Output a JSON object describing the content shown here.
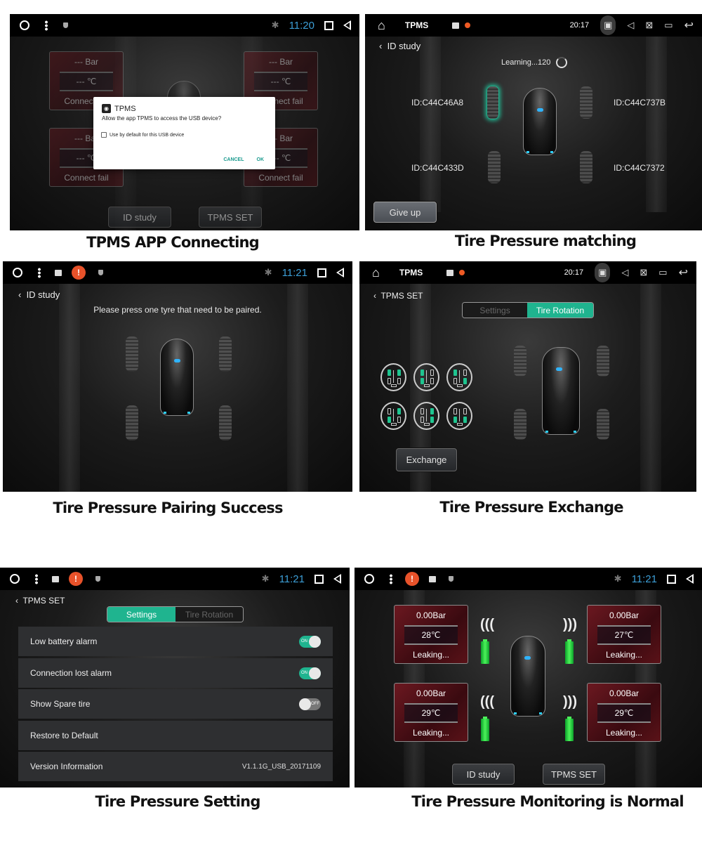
{
  "captions": {
    "p1": "TPMS APP Connecting",
    "p2": "Tire Pressure matching",
    "p3": "Tire Pressure Pairing Success",
    "p4": "Tire Pressure Exchange",
    "p5": "Tire Pressure Setting",
    "p6": "Tire Pressure Monitoring is Normal"
  },
  "panel1": {
    "status": {
      "time": "11:20"
    },
    "cards": [
      {
        "pressure": "--- Bar",
        "temp": "--- ℃",
        "status": "Connect fail"
      },
      {
        "pressure": "--- Bar",
        "temp": "--- ℃",
        "status": "Connect fail"
      },
      {
        "pressure": "--- Bar",
        "temp": "--- ℃",
        "status": "Connect fail"
      },
      {
        "pressure": "--- Bar",
        "temp": "--- ℃",
        "status": "Connect fail"
      }
    ],
    "buttons": {
      "id_study": "ID study",
      "tpms_set": "TPMS SET"
    },
    "dialog": {
      "app_name": "TPMS",
      "message": "Allow the app TPMS to access the USB device?",
      "checkbox_label": "Use by default for this USB device",
      "checkbox_checked": false,
      "cancel": "CANCEL",
      "ok": "OK"
    }
  },
  "panel2": {
    "status": {
      "app_title": "TPMS",
      "time": "20:17"
    },
    "back_label": "ID study",
    "learning": "Learning...120",
    "ids": {
      "fl": "ID:C44C46A8",
      "fr": "ID:C44C737B",
      "rl": "ID:C44C433D",
      "rr": "ID:C44C7372"
    },
    "give_up": "Give up"
  },
  "panel3": {
    "status": {
      "time": "11:21"
    },
    "back_label": "ID study",
    "instruction": "Please press one tyre that need to be paired."
  },
  "panel4": {
    "status": {
      "app_title": "TPMS",
      "time": "20:17"
    },
    "back_label": "TPMS SET",
    "tabs": {
      "settings": "Settings",
      "rotation": "Tire Rotation",
      "active": "Tire Rotation"
    },
    "exchange": "Exchange"
  },
  "panel5": {
    "status": {
      "time": "11:21"
    },
    "back_label": "TPMS SET",
    "tabs": {
      "settings": "Settings",
      "rotation": "Tire Rotation",
      "active": "Settings"
    },
    "rows": [
      {
        "label": "Low battery alarm",
        "toggle": "ON"
      },
      {
        "label": "Connection lost alarm",
        "toggle": "ON"
      },
      {
        "label": "Show Spare tire",
        "toggle": "OFF"
      },
      {
        "label": "Restore to Default"
      },
      {
        "label": "Version Information",
        "value": "V1.1.1G_USB_20171109"
      }
    ]
  },
  "panel6": {
    "status": {
      "time": "11:21"
    },
    "cards": [
      {
        "pressure": "0.00Bar",
        "temp": "28℃",
        "status": "Leaking..."
      },
      {
        "pressure": "0.00Bar",
        "temp": "27℃",
        "status": "Leaking..."
      },
      {
        "pressure": "0.00Bar",
        "temp": "29℃",
        "status": "Leaking..."
      },
      {
        "pressure": "0.00Bar",
        "temp": "29℃",
        "status": "Leaking..."
      }
    ],
    "buttons": {
      "id_study": "ID study",
      "tpms_set": "TPMS SET"
    }
  },
  "colors": {
    "accent": "#1fb48f",
    "clock": "#3c9ed6",
    "alert": "#e8522a",
    "card": "#6b1820"
  }
}
